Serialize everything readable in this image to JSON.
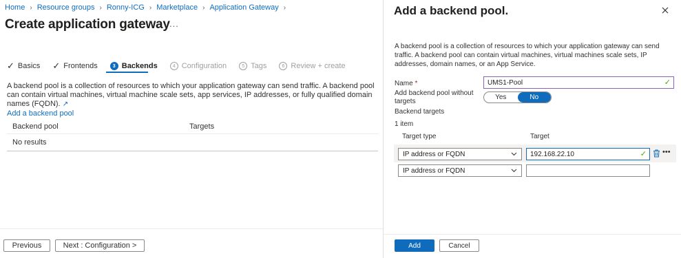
{
  "breadcrumb": {
    "items": [
      "Home",
      "Resource groups",
      "Ronny-ICG",
      "Marketplace",
      "Application Gateway"
    ]
  },
  "page": {
    "title": "Create application gateway",
    "more": "..."
  },
  "tabs": [
    {
      "label": "Basics",
      "state": "done"
    },
    {
      "label": "Frontends",
      "state": "done"
    },
    {
      "label": "Backends",
      "state": "active",
      "num": "3"
    },
    {
      "label": "Configuration",
      "state": "disabled",
      "num": "4"
    },
    {
      "label": "Tags",
      "state": "disabled",
      "num": "5"
    },
    {
      "label": "Review + create",
      "state": "disabled",
      "num": "6"
    }
  ],
  "backends": {
    "description": "A backend pool is a collection of resources to which your application gateway can send traffic. A backend pool can contain virtual machines, virtual machine scale sets, app services, IP addresses, or fully qualified domain names (FQDN).",
    "add_link": "Add a backend pool",
    "columns": [
      "Backend pool",
      "Targets"
    ],
    "empty_text": "No results"
  },
  "footer": {
    "previous": "Previous",
    "next": "Next : Configuration >"
  },
  "blade": {
    "title": "Add a backend pool.",
    "description": "A backend pool is a collection of resources to which your application gateway can send traffic. A backend pool can contain virtual machines, virtual machines scale sets, IP addresses, domain names, or an App Service.",
    "name_label": "Name",
    "required_mark": "*",
    "name_value": "UMS1-Pool",
    "without_targets_label_1": "Add backend pool without",
    "without_targets_label_2": "targets",
    "toggle_yes": "Yes",
    "toggle_no": "No",
    "toggle_selected": "No",
    "backend_targets_label": "Backend targets",
    "item_count": "1 item",
    "target_type_header": "Target type",
    "target_header": "Target",
    "rows": [
      {
        "type": "IP address or FQDN",
        "target": "192.168.22.10"
      },
      {
        "type": "IP address or FQDN",
        "target": ""
      }
    ],
    "add_button": "Add",
    "cancel_button": "Cancel"
  },
  "colors": {
    "accent": "#0f6cbd",
    "valid": "#57a300",
    "focus": "#8764b8"
  }
}
